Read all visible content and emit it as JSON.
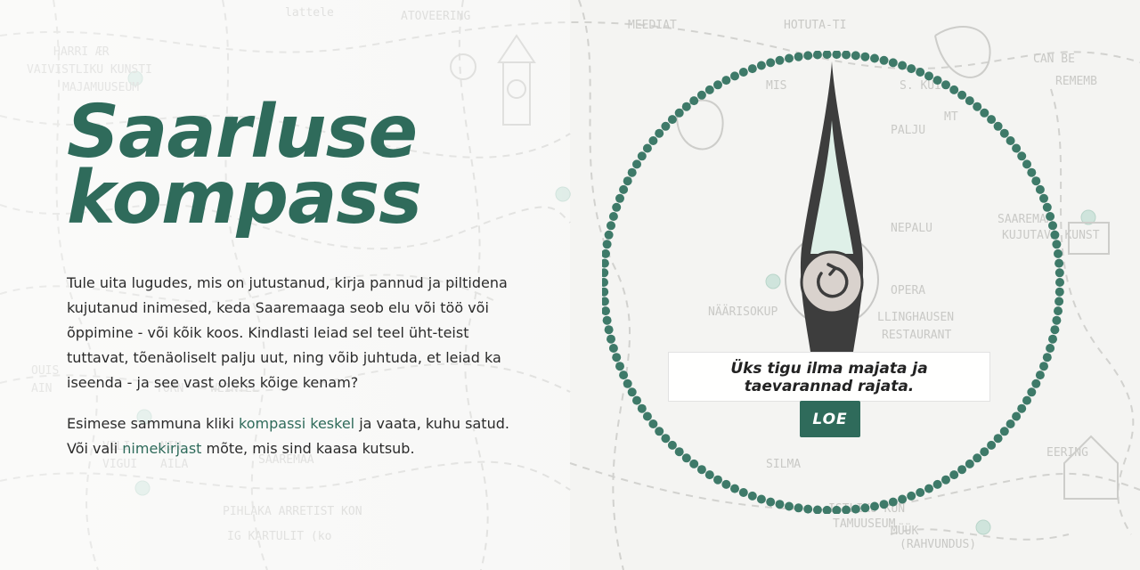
{
  "hero": {
    "title_line1": "Saarluse",
    "title_line2": "kompass"
  },
  "intro": {
    "paragraph1": "Tule uita lugudes, mis on jutustanud, kirja pannud ja piltidena kujutanud inimesed, keda Saaremaaga seob elu või töö või õppimine - või kõik koos. Kindlasti leiad sel teel üht-teist tuttavat, tõenäoliselt palju uut, ning võib juhtuda, et leiad ka iseenda - ja see vast oleks kõige kenam?",
    "p2_before": "Esimese sammuna kliki ",
    "p2_link1": "kompassi keskel",
    "p2_middle": " ja vaata, kuhu satud. Või vali ",
    "p2_link2": "nimekirjast",
    "p2_after": " mõte, mis sind kaasa kutsub."
  },
  "compass": {
    "caption_line1": "Üks tigu ilma majata ja",
    "caption_line2": "taevarannad rajata.",
    "read_button": "LOE",
    "center_icon": "refresh-icon"
  },
  "colors": {
    "accent": "#2f6b5b",
    "ring": "#3e7a69",
    "needle_dark": "#3d3d3d",
    "needle_light": "#dff0e8",
    "hub": "#d9d2cd"
  }
}
